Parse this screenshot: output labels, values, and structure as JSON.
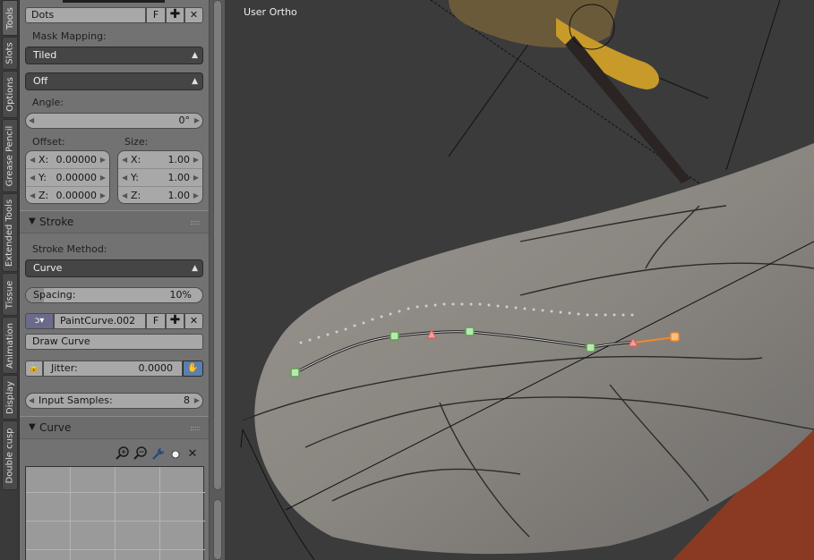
{
  "tabs": [
    "Tools",
    "Slots",
    "Options",
    "Grease Pencil",
    "Extended Tools",
    "Tissue",
    "Animation",
    "Display",
    "Double cusp"
  ],
  "texture": {
    "name": "Dots",
    "fake_user": "F"
  },
  "mask_mapping": {
    "label": "Mask Mapping:",
    "value": "Tiled"
  },
  "random_mode": "Off",
  "angle": {
    "label": "Angle:",
    "value": "0°"
  },
  "offset": {
    "label": "Offset:",
    "fields": [
      {
        "axis": "X:",
        "value": "0.00000"
      },
      {
        "axis": "Y:",
        "value": "0.00000"
      },
      {
        "axis": "Z:",
        "value": "0.00000"
      }
    ]
  },
  "size": {
    "label": "Size:",
    "fields": [
      {
        "axis": "X:",
        "value": "1.00"
      },
      {
        "axis": "Y:",
        "value": "1.00"
      },
      {
        "axis": "Z:",
        "value": "1.00"
      }
    ]
  },
  "stroke": {
    "title": "Stroke",
    "method_label": "Stroke Method:",
    "method_value": "Curve",
    "spacing_label": "Spacing:",
    "spacing_value": "10%",
    "spacing_fraction": 0.1,
    "paint_curve": "PaintCurve.002",
    "fake_user": "F",
    "draw_curve": "Draw Curve",
    "jitter_label": "Jitter:",
    "jitter_value": "0.0000",
    "input_samples_label": "Input Samples:",
    "input_samples_value": "8"
  },
  "curve": {
    "title": "Curve"
  },
  "viewport": {
    "label": "User Ortho"
  },
  "icons": [
    "plus-icon",
    "close-icon",
    "zoom-in-icon",
    "zoom-out-icon",
    "wrench-icon",
    "dot-icon",
    "lock-icon",
    "pressure-icon"
  ],
  "colors": {
    "panel": "#727272",
    "viewport": "#3b3b3b",
    "wing": "#8f8a85",
    "curve_point": "#7ed070",
    "curve_handle": "#e87c7c",
    "active_point": "#f08a2a"
  }
}
